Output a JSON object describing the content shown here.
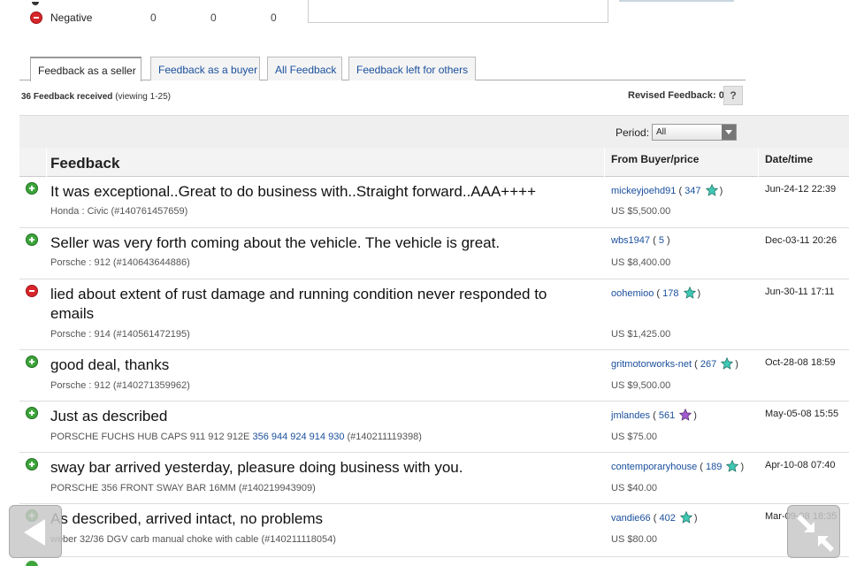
{
  "summary": {
    "negative_label": "Negative",
    "negative_counts": [
      "0",
      "0",
      "0"
    ]
  },
  "tabs": [
    {
      "label": "Feedback as a seller",
      "active": true
    },
    {
      "label": "Feedback as a buyer",
      "active": false
    },
    {
      "label": "All Feedback",
      "active": false
    },
    {
      "label": "Feedback left for others",
      "active": false
    }
  ],
  "received": {
    "count_text": "36 Feedback received",
    "viewing_text": "(viewing 1-25)"
  },
  "revised": {
    "label": "Revised Feedback: 0",
    "help": "?"
  },
  "period": {
    "label": "Period:",
    "selected": "All"
  },
  "table": {
    "headers": {
      "feedback": "Feedback",
      "from": "From Buyer/price",
      "date": "Date/time"
    },
    "rows": [
      {
        "type": "positive",
        "comment": "It was exceptional..Great to do business with..Straight forward..AAA++++",
        "item": "Honda : Civic (#140761457659)",
        "buyer": "mickeyjoehd91",
        "score": "347",
        "star": "teal",
        "price": "US $5,500.00",
        "date": "Jun-24-12 22:39"
      },
      {
        "type": "positive",
        "comment": "Seller was very forth coming about the vehicle. The vehicle is great.",
        "item": "Porsche : 912 (#140643644886)",
        "buyer": "wbs1947",
        "score": "5",
        "star": "",
        "price": "US $8,400.00",
        "date": "Dec-03-11 20:26"
      },
      {
        "type": "negative",
        "comment": "lied about extent of rust damage and running condition never responded to emails",
        "item": "Porsche : 914 (#140561472195)",
        "buyer": "oohemioo",
        "score": "178",
        "star": "teal",
        "price": "US $1,425.00",
        "date": "Jun-30-11 17:11"
      },
      {
        "type": "positive",
        "comment": "good deal, thanks",
        "item": "Porsche : 912 (#140271359962)",
        "buyer": "gritmotorworks-net",
        "score": "267",
        "star": "teal",
        "price": "US $9,500.00",
        "date": "Oct-28-08 18:59"
      },
      {
        "type": "positive",
        "comment": "Just as described",
        "item_prefix": "PORSCHE FUCHS HUB CAPS 911 912 912E ",
        "item_link": "356 944 924 914 930",
        "item_suffix": " (#140211119398)",
        "buyer": "jmlandes",
        "score": "561",
        "star": "purple",
        "price": "US $75.00",
        "date": "May-05-08 15:55"
      },
      {
        "type": "positive",
        "comment": "sway bar arrived yesterday, pleasure doing business with you.",
        "item": "PORSCHE 356 FRONT SWAY BAR 16MM (#140219943909)",
        "buyer": "contemporaryhouse",
        "score": "189",
        "star": "teal",
        "price": "US $40.00",
        "date": "Apr-10-08 07:40"
      },
      {
        "type": "positive",
        "comment": "As described, arrived intact, no problems",
        "item": "weber 32/36 DGV carb manual choke with cable (#140211118054)",
        "buyer": "vandie66",
        "score": "402",
        "star": "teal",
        "price": "US $80.00",
        "date": "Mar-09-08 18:35"
      }
    ]
  },
  "colors": {
    "link": "#1a4f9c",
    "star_teal": "#3fc9b4",
    "star_purple": "#a25bd0",
    "positive": "#3da53b",
    "negative": "#d8262b"
  }
}
